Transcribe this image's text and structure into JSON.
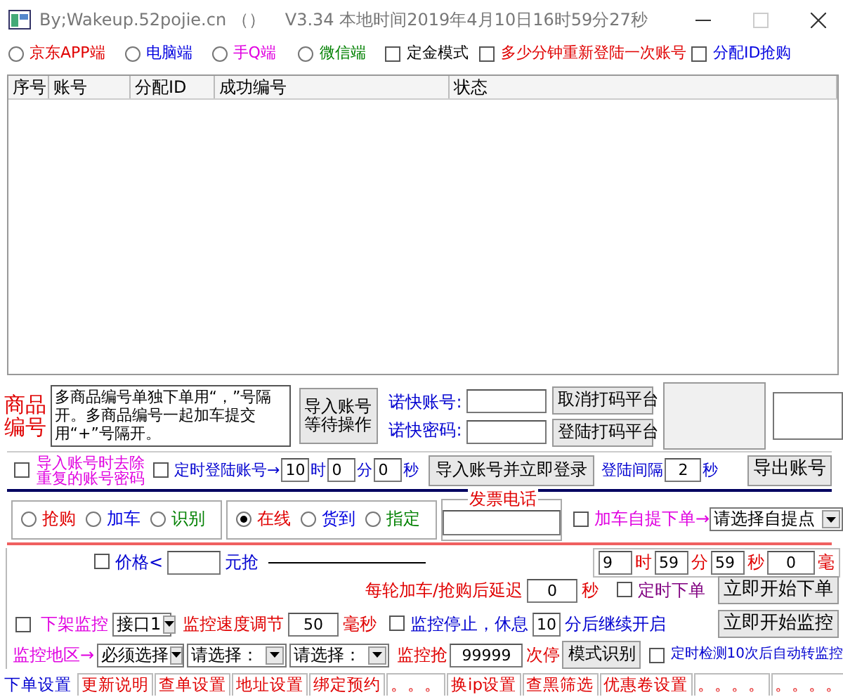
{
  "window": {
    "title": "By;Wakeup.52pojie.cn （）",
    "info": "V3.34 本地时间2019年4月10日16时59分27秒"
  },
  "clients": [
    {
      "label": "京东APP端",
      "selected": false,
      "color": "#e00000"
    },
    {
      "label": "电脑端",
      "selected": false,
      "color": "#0000e0"
    },
    {
      "label": "手Q端",
      "selected": false,
      "color": "#e000e0"
    },
    {
      "label": "微信端",
      "selected": false,
      "color": "#008000"
    }
  ],
  "modes": [
    {
      "label": "定金模式",
      "checked": false,
      "color": "#000000"
    },
    {
      "label": "多少分钟重新登陆一次账号",
      "checked": false,
      "color": "#e00000"
    },
    {
      "label": "分配ID抢购",
      "checked": false,
      "color": "#0000e0"
    }
  ],
  "table": {
    "columns": [
      "序号",
      "账号",
      "分配ID",
      "成功编号",
      "状态"
    ]
  },
  "product": {
    "label": "商品编号",
    "value": "多商品编号单独下单用“，”号隔开。多商品编号一起加车提交用“+”号隔开。"
  },
  "import_wait_button": "导入账号等待操作",
  "captcha": {
    "account_label": "诺快账号:",
    "password_label": "诺快密码:",
    "cancel_button": "取消打码平台",
    "login_button": "登陆打码平台"
  },
  "login_row": {
    "dedupe": {
      "label": "导入账号时去除重复的账号密码",
      "checked": false
    },
    "timed": {
      "label": "定时登陆账号→",
      "checked": false
    },
    "time": [
      {
        "value": "10",
        "unit": "时"
      },
      {
        "value": "0",
        "unit": "分"
      },
      {
        "value": "0",
        "unit": "秒"
      }
    ],
    "import_login_button": "导入账号并立即登录",
    "interval_label": "登陆间隔",
    "interval": "2",
    "interval_unit": "秒",
    "export_button": "导出账号"
  },
  "actions": [
    {
      "label": "抢购",
      "selected": false,
      "color": "#e00000"
    },
    {
      "label": "加车",
      "selected": false,
      "color": "#0000e0"
    },
    {
      "label": "识别",
      "selected": false,
      "color": "#008000"
    }
  ],
  "payments": [
    {
      "label": "在线",
      "selected": true,
      "color": "#e00000"
    },
    {
      "label": "货到",
      "selected": false,
      "color": "#0000e0"
    },
    {
      "label": "指定",
      "selected": false,
      "color": "#008000"
    }
  ],
  "invoice_phone": {
    "legend": "发票电话"
  },
  "pickup": {
    "label": "加车自提下单→",
    "checked": false,
    "select": "请选择自提点"
  },
  "price": {
    "label": "价格<",
    "checked": false,
    "unit": "元抢"
  },
  "order_time": [
    {
      "value": "9",
      "unit": "时"
    },
    {
      "value": "59",
      "unit": "分"
    },
    {
      "value": "59",
      "unit": "秒"
    },
    {
      "value": "0",
      "unit": "毫"
    }
  ],
  "delay": {
    "label": "每轮加车/抢购后延迟",
    "value": "0",
    "unit": "秒"
  },
  "timed_order": {
    "label": "定时下单",
    "checked": false
  },
  "start_order_button": "立即开始下单",
  "monitor": {
    "offshelf": {
      "label": "下架监控",
      "checked": false
    },
    "api": "接口1",
    "speed_label": "监控速度调节",
    "speed": "50",
    "speed_unit": "毫秒",
    "pause": {
      "label": "监控停止，休息",
      "checked": false
    },
    "rest": "10",
    "rest_unit": "分后继续开启",
    "start_button": "立即开始监控"
  },
  "region": {
    "label": "监控地区→",
    "selects": [
      "必须选择",
      "请选择：",
      "请选择："
    ],
    "count_label": "监控抢",
    "count": "99999",
    "count_unit": "次停",
    "mode_button": "模式识别",
    "auto": {
      "label": "定时检测10次后自动转监控",
      "checked": false
    }
  },
  "tabs": [
    {
      "label": "下单设置",
      "selected": true
    },
    {
      "label": "更新说明",
      "selected": false
    },
    {
      "label": "查单设置",
      "selected": false
    },
    {
      "label": "地址设置",
      "selected": false
    },
    {
      "label": "绑定预约",
      "selected": false
    },
    {
      "label": "。。。",
      "selected": false
    },
    {
      "label": "换ip设置",
      "selected": false
    },
    {
      "label": "查黑筛选",
      "selected": false
    },
    {
      "label": "优惠卷设置",
      "selected": false
    },
    {
      "label": "。。。。",
      "selected": false
    },
    {
      "label": "。。。。",
      "selected": false
    }
  ]
}
